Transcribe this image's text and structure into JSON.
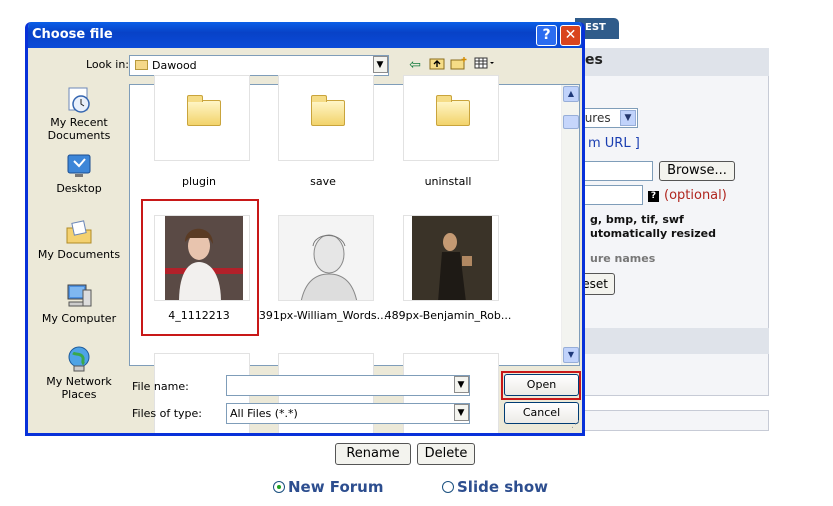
{
  "page": {
    "tab_label": "EST",
    "panel_title": "es",
    "select_value": "tures",
    "url_link": "m URL ]",
    "browse_label": "Browse...",
    "help_glyph": "?",
    "optional_label": "(optional)",
    "formats_line1": "g, bmp, tif, swf",
    "formats_line2": "utomatically resized",
    "picture_names": "ure names",
    "reset_label": "eset",
    "rename_label": "Rename",
    "delete_label": "Delete",
    "radio_new_forum": "New Forum",
    "radio_slide_show": "Slide show",
    "selected_radio": "New Forum"
  },
  "dialog": {
    "title": "Choose file",
    "help_glyph": "?",
    "close_glyph": "✕",
    "look_in_label": "Look in:",
    "look_in_value": "Dawood",
    "places": [
      {
        "label": "My Recent Documents",
        "icon": "recent-documents-icon"
      },
      {
        "label": "Desktop",
        "icon": "desktop-icon"
      },
      {
        "label": "My Documents",
        "icon": "my-documents-icon"
      },
      {
        "label": "My Computer",
        "icon": "my-computer-icon"
      },
      {
        "label": "My Network Places",
        "icon": "network-places-icon"
      }
    ],
    "items": [
      {
        "label": "plugin",
        "type": "folder"
      },
      {
        "label": "save",
        "type": "folder"
      },
      {
        "label": "uninstall",
        "type": "folder"
      },
      {
        "label": "4_1112213",
        "type": "image",
        "selected": true
      },
      {
        "label": "391px-William_Words...",
        "type": "image"
      },
      {
        "label": "489px-Benjamin_Rob...",
        "type": "image"
      }
    ],
    "file_name_label": "File name:",
    "file_name_value": "",
    "files_of_type_label": "Files of type:",
    "files_of_type_value": "All Files (*.*)",
    "open_label": "Open",
    "cancel_label": "Cancel"
  },
  "colors": {
    "title_bar": "#0a4ad8",
    "highlight": "#c81818",
    "dialog_bg": "#ece9d8"
  }
}
